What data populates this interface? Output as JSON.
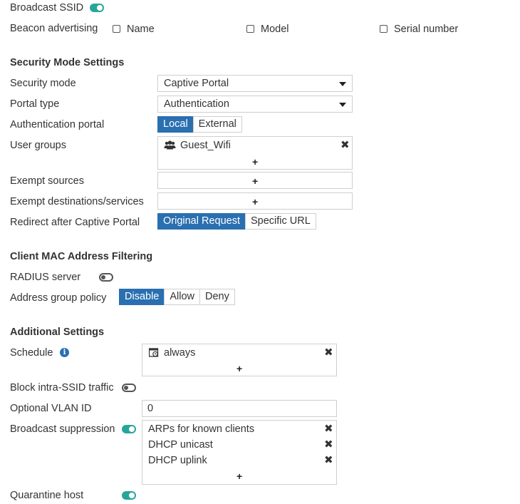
{
  "broadcast_ssid": {
    "label": "Broadcast SSID",
    "enabled": true
  },
  "beacon_advertising": {
    "label": "Beacon advertising",
    "options": [
      {
        "label": "Name",
        "checked": false
      },
      {
        "label": "Model",
        "checked": false
      },
      {
        "label": "Serial number",
        "checked": false
      }
    ]
  },
  "security": {
    "heading": "Security Mode Settings",
    "security_mode": {
      "label": "Security mode",
      "value": "Captive Portal"
    },
    "portal_type": {
      "label": "Portal type",
      "value": "Authentication"
    },
    "auth_portal": {
      "label": "Authentication portal",
      "options": [
        "Local",
        "External"
      ],
      "selected": "Local"
    },
    "user_groups": {
      "label": "User groups",
      "items": [
        "Guest_Wifi"
      ],
      "add": "+"
    },
    "exempt_sources": {
      "label": "Exempt sources",
      "add": "+"
    },
    "exempt_destinations": {
      "label": "Exempt destinations/services",
      "add": "+"
    },
    "redirect": {
      "label": "Redirect after Captive Portal",
      "options": [
        "Original Request",
        "Specific URL"
      ],
      "selected": "Original Request"
    }
  },
  "mac_filtering": {
    "heading": "Client MAC Address Filtering",
    "radius": {
      "label": "RADIUS server",
      "enabled": false
    },
    "address_group_policy": {
      "label": "Address group policy",
      "options": [
        "Disable",
        "Allow",
        "Deny"
      ],
      "selected": "Disable"
    }
  },
  "additional": {
    "heading": "Additional Settings",
    "schedule": {
      "label": "Schedule",
      "items": [
        "always"
      ],
      "add": "+"
    },
    "block_intra_ssid": {
      "label": "Block intra-SSID traffic",
      "enabled": false
    },
    "vlan": {
      "label": "Optional VLAN ID",
      "value": "0"
    },
    "broadcast_suppression": {
      "label": "Broadcast suppression",
      "enabled": true,
      "items": [
        "ARPs for known clients",
        "DHCP unicast",
        "DHCP uplink"
      ],
      "add": "+"
    },
    "quarantine": {
      "label": "Quarantine host",
      "enabled": true
    }
  },
  "colors": {
    "accent": "#2a6fb0",
    "toggle_on": "#26a69a"
  },
  "icons": {
    "remove": "close-icon",
    "info": "info-icon",
    "group": "users-icon",
    "schedule": "schedule-icon"
  }
}
